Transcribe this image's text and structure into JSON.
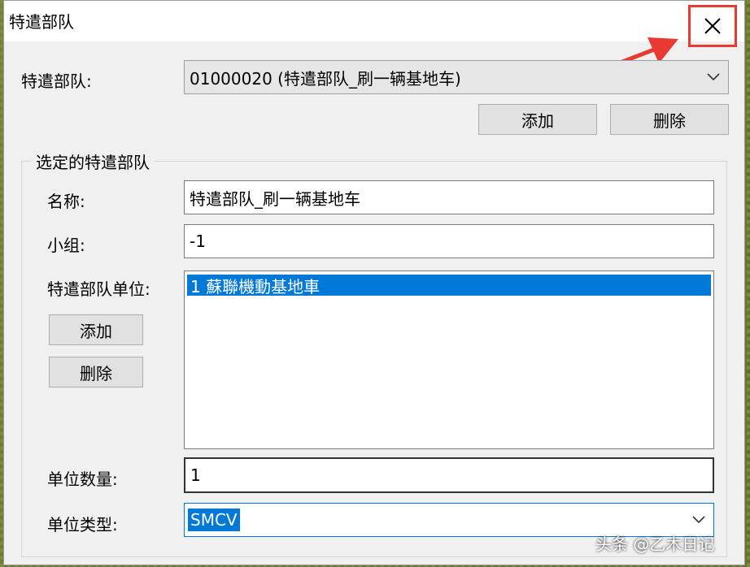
{
  "window": {
    "title": "特遣部队"
  },
  "top": {
    "team_label": "特遣部队:",
    "team_selected": "01000020 (特遣部队_刷一辆基地车)",
    "add_label": "添加",
    "delete_label": "删除"
  },
  "group": {
    "title": "选定的特遣部队",
    "name_label": "名称:",
    "name_value": "特遣部队_刷一辆基地车",
    "team_group_label": "小组:",
    "team_group_value": "-1",
    "units_label": "特遣部队单位:",
    "units": [
      "1 蘇聯機動基地車"
    ],
    "unit_add_label": "添加",
    "unit_delete_label": "删除",
    "count_label": "单位数量:",
    "count_value": "1",
    "type_label": "单位类型:",
    "type_value": "SMCV"
  },
  "watermark": "头条 @乙木日记",
  "colors": {
    "accent": "#0078d7",
    "highlight": "#e83a32"
  }
}
